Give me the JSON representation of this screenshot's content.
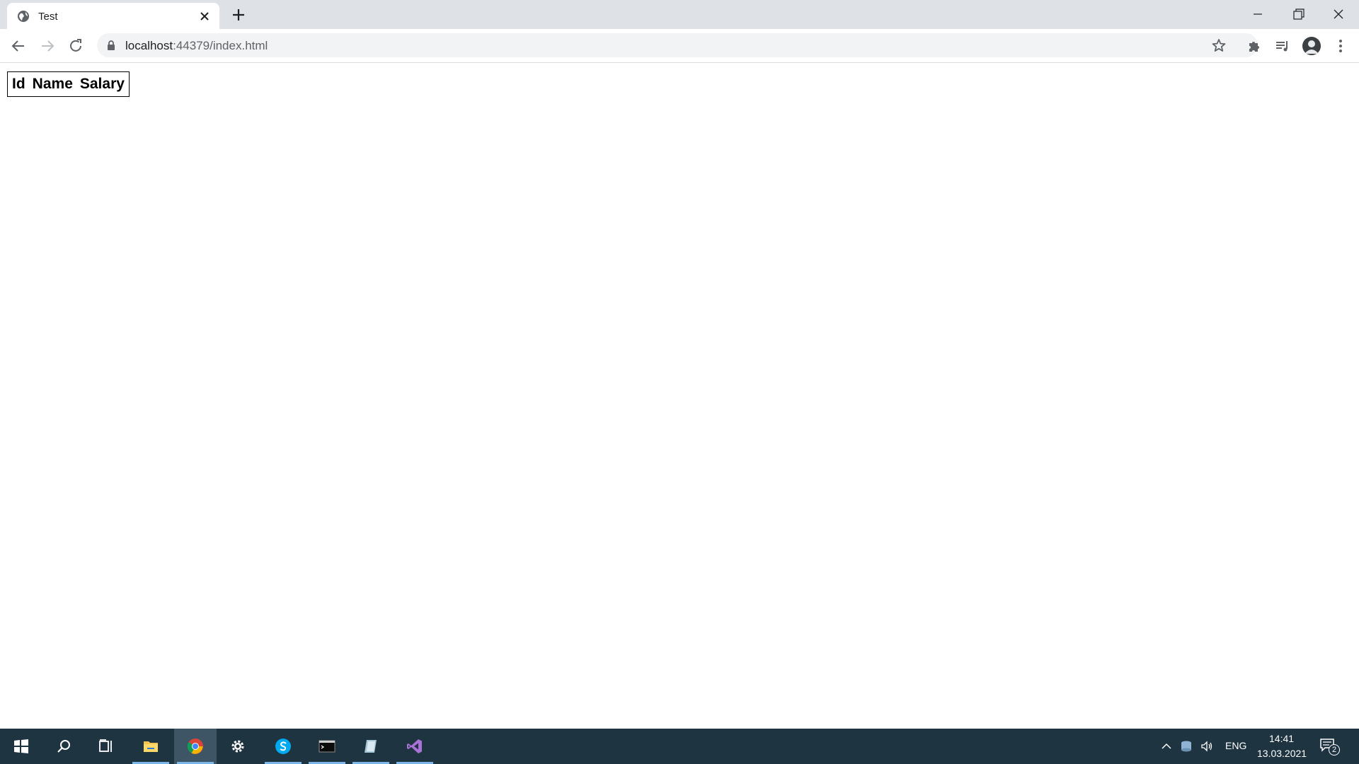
{
  "browser": {
    "tab_title": "Test",
    "url_host": "localhost",
    "url_rest": ":44379/index.html"
  },
  "table": {
    "headers": [
      "Id",
      "Name",
      "Salary"
    ]
  },
  "taskbar": {
    "language": "ENG",
    "time": "14:41",
    "date": "13.03.2021",
    "notification_count": "2"
  }
}
